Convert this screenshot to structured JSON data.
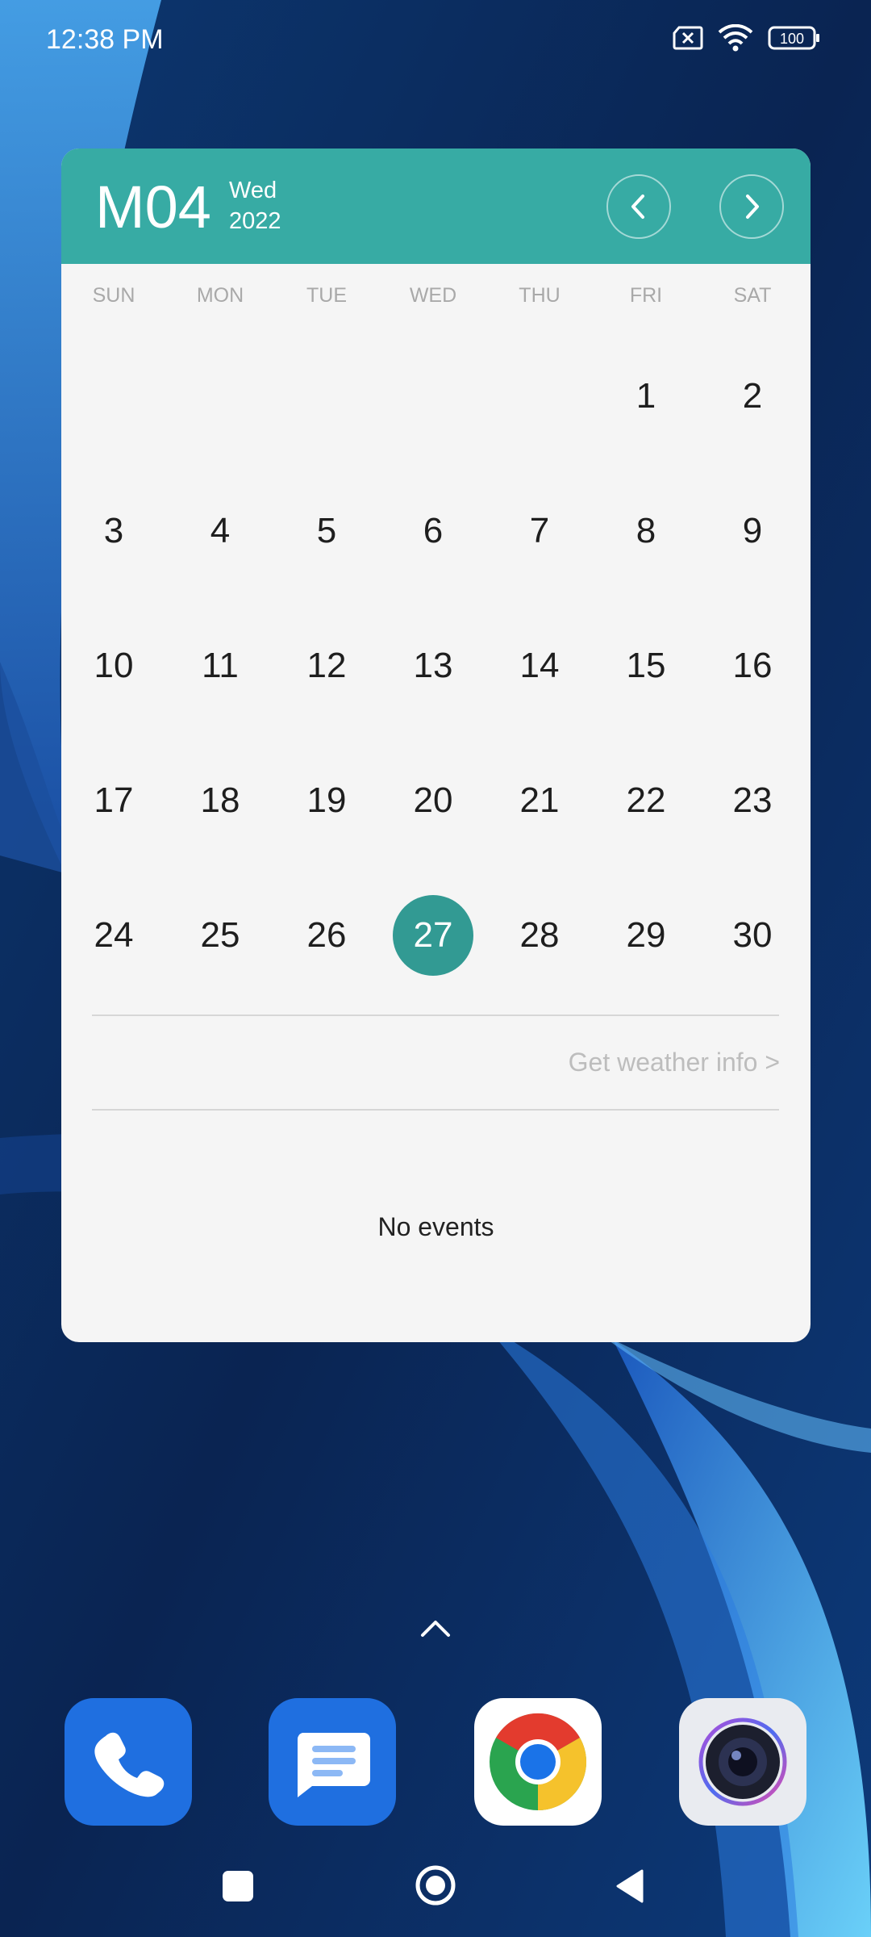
{
  "status_bar": {
    "time": "12:38 PM",
    "battery": "100"
  },
  "calendar_widget": {
    "month": "M04",
    "weekday": "Wed",
    "year": "2022",
    "day_headers": [
      "SUN",
      "MON",
      "TUE",
      "WED",
      "THU",
      "FRI",
      "SAT"
    ],
    "weeks": [
      [
        "",
        "",
        "",
        "",
        "",
        "1",
        "2"
      ],
      [
        "3",
        "4",
        "5",
        "6",
        "7",
        "8",
        "9"
      ],
      [
        "10",
        "11",
        "12",
        "13",
        "14",
        "15",
        "16"
      ],
      [
        "17",
        "18",
        "19",
        "20",
        "21",
        "22",
        "23"
      ],
      [
        "24",
        "25",
        "26",
        "27",
        "28",
        "29",
        "30"
      ]
    ],
    "selected_day": "27",
    "weather_link": "Get weather info >",
    "events_text": "No events",
    "accent_color": "#37aba4"
  },
  "dock": {
    "apps": [
      {
        "name": "Phone",
        "icon": "phone-icon"
      },
      {
        "name": "Messages",
        "icon": "messages-icon"
      },
      {
        "name": "Chrome",
        "icon": "chrome-icon"
      },
      {
        "name": "Camera",
        "icon": "camera-icon"
      }
    ]
  },
  "nav_bar": {
    "icons": [
      "recents-icon",
      "home-icon",
      "back-icon"
    ]
  }
}
